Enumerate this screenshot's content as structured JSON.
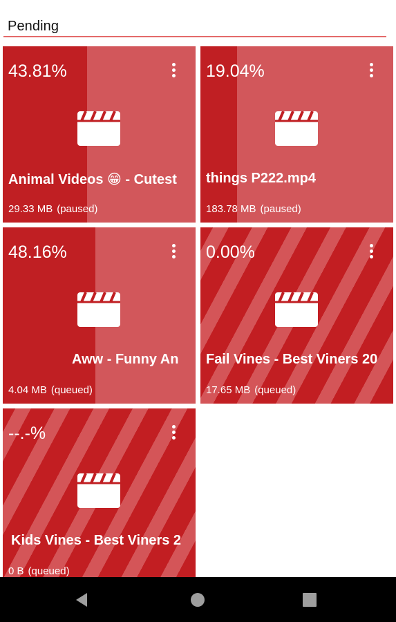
{
  "header": {
    "title": "Pending"
  },
  "colors": {
    "accent": "#c01f23",
    "card_bg": "#d2575b",
    "header_line": "#e46a6a"
  },
  "downloads": [
    {
      "percent_label": "43.81%",
      "progress": 0.4381,
      "title": "Animal Videos 😁 - Cutest",
      "size": "29.33 MB",
      "state": "(paused)",
      "icon": "video-clapperboard-icon"
    },
    {
      "percent_label": "19.04%",
      "progress": 0.1904,
      "title": "things P222.mp4",
      "size": "183.78 MB",
      "state": "(paused)",
      "icon": "video-clapperboard-icon"
    },
    {
      "percent_label": "48.16%",
      "progress": 0.4816,
      "title": "Aww - Funny An",
      "size": "4.04 MB",
      "state": "(queued)",
      "icon": "video-clapperboard-icon"
    },
    {
      "percent_label": "0.00%",
      "progress": 0.0,
      "title": "Fail Vines - Best Viners 20",
      "size": "17.65 MB",
      "state": "(queued)",
      "icon": "video-clapperboard-icon"
    },
    {
      "percent_label": "--.-%",
      "progress": null,
      "title": "Kids Vines - Best Viners 2",
      "size": "0 B",
      "state": "(queued)",
      "icon": "video-clapperboard-icon"
    }
  ],
  "navbar": {
    "back_icon": "back-triangle-icon",
    "home_icon": "home-circle-icon",
    "recents_icon": "recents-square-icon"
  }
}
